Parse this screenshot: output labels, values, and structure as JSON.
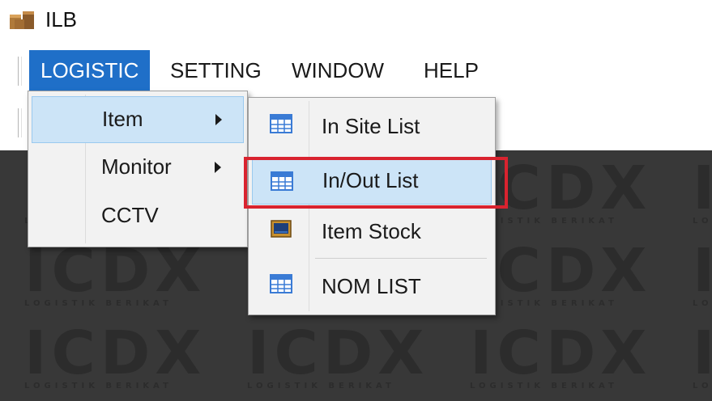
{
  "window": {
    "title": "ILB"
  },
  "menubar": {
    "items": [
      {
        "label": "LOGISTIC"
      },
      {
        "label": "SETTING"
      },
      {
        "label": "WINDOW"
      },
      {
        "label": "HELP"
      }
    ]
  },
  "logistic_menu": {
    "items": [
      {
        "label": "Item"
      },
      {
        "label": "Monitor"
      },
      {
        "label": "CCTV"
      }
    ]
  },
  "item_submenu": {
    "items": [
      {
        "label": "In Site List",
        "icon": "grid-icon"
      },
      {
        "label": "In/Out List",
        "icon": "grid-icon"
      },
      {
        "label": "Item Stock",
        "icon": "monitor-icon"
      },
      {
        "label": "NOM LIST",
        "icon": "grid-icon"
      }
    ]
  },
  "colors": {
    "menu_active": "#1f6fc8",
    "selection": "#cce4f7",
    "workspace": "#383838",
    "annotation": "#d9232f"
  }
}
